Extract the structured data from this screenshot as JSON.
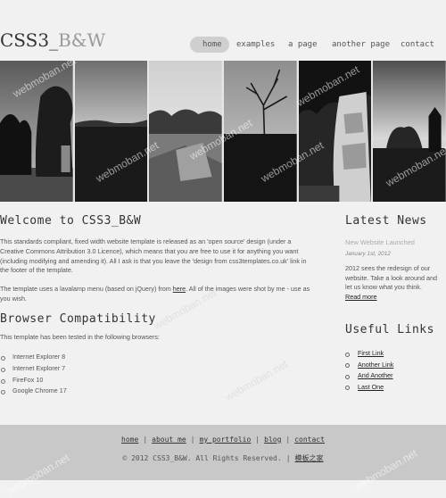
{
  "site": {
    "logo_main": "CSS3_",
    "logo_accent": "B&W"
  },
  "nav": {
    "items": [
      {
        "label": "home",
        "active": true
      },
      {
        "label": "examples"
      },
      {
        "label": "a page"
      },
      {
        "label": "another page"
      },
      {
        "label": "contact"
      }
    ]
  },
  "photos": [
    {
      "icon": "ruins-trees-photo"
    },
    {
      "icon": "sky-field-photo"
    },
    {
      "icon": "stone-ruins-photo"
    },
    {
      "icon": "bare-tree-photo"
    },
    {
      "icon": "castle-wall-photo"
    },
    {
      "icon": "church-trees-photo"
    }
  ],
  "main": {
    "welcome_title": "Welcome to CSS3_B&W",
    "welcome_para1": "This standards compliant, fixed width website template is released as an 'open source' design (under a Creative Commons Attribution 3.0 Licence), which means that you are free to use it for anything you want (including modifying and amending it). All I ask is that you leave the 'design from css3templates.co.uk' link in the footer of the template.",
    "welcome_para2_pre": "The template uses a lavalamp menu (based on jQuery) from ",
    "welcome_para2_link": "here",
    "welcome_para2_post": ". All of the images were shot by me - use as you wish.",
    "browser_title": "Browser Compatibility",
    "browser_intro": "This template has been tested in the following browsers:",
    "browsers": [
      "Internet Explorer 8",
      "Internet Explorer 7",
      "FireFox 10",
      "Google Chrome 17"
    ]
  },
  "sidebar": {
    "news_title": "Latest News",
    "news_item_title": "New Website Launched",
    "news_item_date": "January 1st, 2012",
    "news_item_body": "2012 sees the redesign of our website. Take a look around and let us know what you think.",
    "news_item_more": "Read more",
    "links_title": "Useful Links",
    "links": [
      "First Link",
      "Another Link",
      "And Another",
      "Last One"
    ]
  },
  "footer": {
    "links": [
      "home",
      "about me",
      "my portfolio",
      "blog",
      "contact"
    ],
    "copyright": "© 2012 CSS3_B&W. All Rights Reserved.",
    "credit_link": "模板之家"
  },
  "watermark": {
    "text": "webmoban.net"
  }
}
